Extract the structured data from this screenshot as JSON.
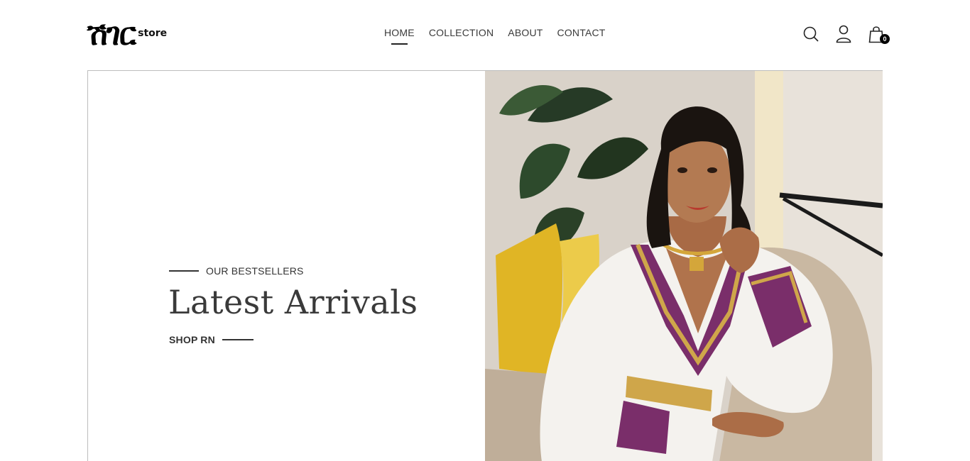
{
  "header": {
    "logo_mark": "ሽገር",
    "logo_sub": "store",
    "nav": [
      {
        "label": "HOME"
      },
      {
        "label": "COLLECTION"
      },
      {
        "label": "ABOUT"
      },
      {
        "label": "CONTACT"
      }
    ],
    "icons": [
      "search-icon",
      "user-icon",
      "shopping-bag-icon"
    ],
    "cart_count": "0"
  },
  "hero": {
    "eyebrow": "OUR BESTSELLERS",
    "title": "Latest Arrivals",
    "cta": "SHOP RN",
    "image_alt": "Model wearing a white habesha dress with purple and gold embroidery"
  },
  "colors": {
    "text": "#333333",
    "badge": "#000000",
    "border": "#bdbdbd"
  }
}
